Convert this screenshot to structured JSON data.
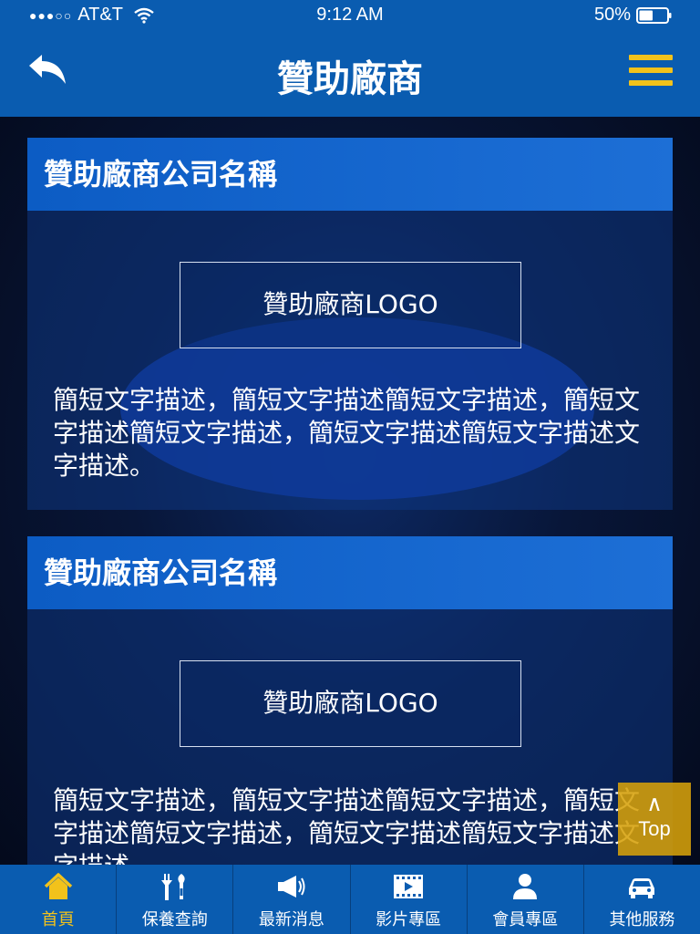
{
  "status_bar": {
    "signal": "●●●○○",
    "carrier": "AT&T",
    "time": "9:12 AM",
    "battery_percent": "50%",
    "battery_level": 0.5
  },
  "nav": {
    "title": "贊助廠商",
    "back_icon": "back-arrow-icon",
    "menu_icon": "hamburger-menu-icon"
  },
  "colors": {
    "nav_blue": "#0a5cb0",
    "accent_yellow": "#f2c21b",
    "top_button": "#d6a00a"
  },
  "sponsors": [
    {
      "name": "贊助廠商公司名稱",
      "logo_label": "贊助廠商LOGO",
      "description": "簡短文字描述，簡短文字描述簡短文字描述，簡短文字描述簡短文字描述，簡短文字描述簡短文字描述文字描述。"
    },
    {
      "name": "贊助廠商公司名稱",
      "logo_label": "贊助廠商LOGO",
      "description": "簡短文字描述，簡短文字描述簡短文字描述，簡短文字描述簡短文字描述，簡短文字描述簡短文字描述文字描述。"
    }
  ],
  "top_button": {
    "arrow": "∧",
    "label": "Top"
  },
  "tabs": [
    {
      "label": "首頁",
      "icon": "home-icon",
      "active": true
    },
    {
      "label": "保養查詢",
      "icon": "tools-icon",
      "active": false
    },
    {
      "label": "最新消息",
      "icon": "megaphone-icon",
      "active": false
    },
    {
      "label": "影片專區",
      "icon": "film-icon",
      "active": false
    },
    {
      "label": "會員專區",
      "icon": "user-icon",
      "active": false
    },
    {
      "label": "其他服務",
      "icon": "car-icon",
      "active": false
    }
  ]
}
